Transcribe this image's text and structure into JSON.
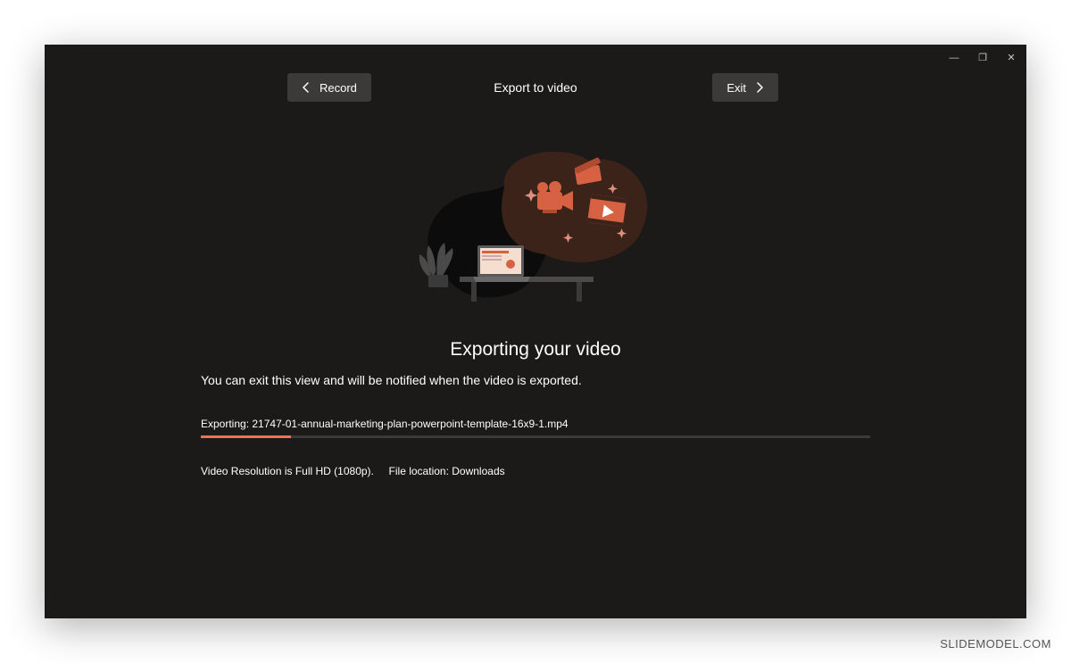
{
  "window": {
    "minimize": "—",
    "maximize": "❐",
    "close": "✕"
  },
  "nav": {
    "record_label": "Record",
    "title": "Export to video",
    "exit_label": "Exit"
  },
  "main": {
    "heading": "Exporting your video",
    "subtext": "You can exit this view and will be notified when the video is exported.",
    "export_prefix": "Exporting: ",
    "export_filename": "21747-01-annual-marketing-plan-powerpoint-template-16x9-1.mp4",
    "progress_percent": 13.5,
    "resolution_text": "Video Resolution is Full HD (1080p).",
    "location_text": "File location: Downloads"
  },
  "watermark": "SLIDEMODEL.COM",
  "colors": {
    "accent": "#f2734e",
    "bg": "#1b1a19"
  }
}
